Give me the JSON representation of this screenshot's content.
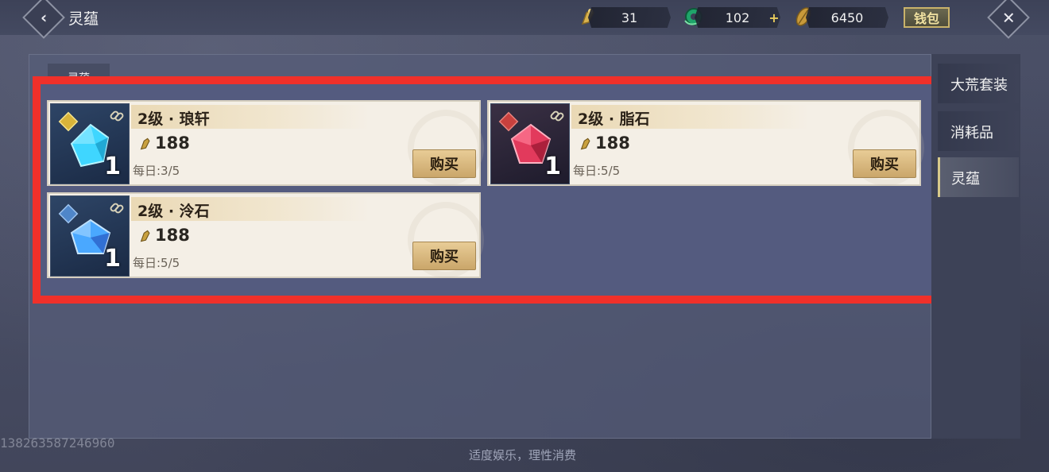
{
  "header": {
    "title": "灵蕴",
    "resources": [
      {
        "name": "bell-token-icon",
        "value": "31"
      },
      {
        "name": "jade-icon",
        "value": "102"
      },
      {
        "name": "gold-leaf-icon",
        "value": "6450"
      }
    ],
    "wallet_label": "钱包",
    "plus_symbol": "+"
  },
  "inner_tab": {
    "label": "灵蕴"
  },
  "side_tabs": [
    {
      "label": "大荒套装",
      "active": false
    },
    {
      "label": "消耗品",
      "active": false
    },
    {
      "label": "灵蕴",
      "active": true
    }
  ],
  "items": [
    {
      "name": "2级 · 琅轩",
      "quantity": "1",
      "price": "188",
      "daily": "每日:3/5",
      "buy_label": "购买",
      "gem_color": "#3fd6ff",
      "badge_color": "#d8b43a"
    },
    {
      "name": "2级 · 脂石",
      "quantity": "1",
      "price": "188",
      "daily": "每日:5/5",
      "buy_label": "购买",
      "gem_color": "#e23a5c",
      "badge_color": "#c9413e"
    },
    {
      "name": "2级 · 泠石",
      "quantity": "1",
      "price": "188",
      "daily": "每日:5/5",
      "buy_label": "购买",
      "gem_color": "#4aa8ff",
      "badge_color": "#4f86c9"
    }
  ],
  "footer": {
    "user_id": "138263587246960",
    "note": "适度娱乐，理性消费"
  },
  "colors": {
    "highlight": "#f0302a",
    "accent_gold": "#d7c98a"
  }
}
